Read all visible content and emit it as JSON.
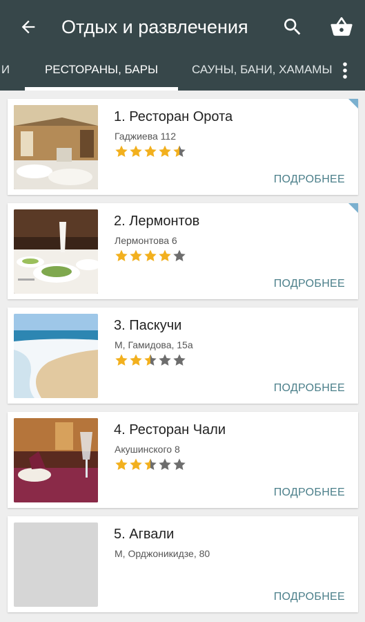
{
  "toolbar": {
    "title": "Отдых и развлечения",
    "back_icon": "arrow-back-icon",
    "search_icon": "search-icon",
    "cart_icon": "basket-icon"
  },
  "tabs": {
    "items": [
      {
        "label": "И"
      },
      {
        "label": "РЕСТОРАНЫ, БАРЫ"
      },
      {
        "label": "САУНЫ, БАНИ, ХАМАМЫ"
      }
    ],
    "active_index": 1,
    "overflow_icon": "more-vertical-icon"
  },
  "colors": {
    "appbar": "#37474a",
    "accent_text": "#4b7f8a",
    "star_filled": "#f2b01e",
    "star_empty": "#6d6d6d",
    "corner_marker": "#7ab0cf"
  },
  "places": [
    {
      "name": "1. Ресторан Орота",
      "address": "Гаджиева 112",
      "rating": 4.5,
      "has_photo": true,
      "photo": "restaurant-hall",
      "featured": true,
      "more_label": "ПОДРОБНЕЕ"
    },
    {
      "name": "2. Лермонтов",
      "address": "Лермонтова 6",
      "rating": 4,
      "has_photo": true,
      "photo": "table-setting",
      "featured": true,
      "more_label": "ПОДРОБНЕЕ"
    },
    {
      "name": "3. Паскучи",
      "address": "М, Гамидова, 15а",
      "rating": 2.5,
      "has_photo": true,
      "photo": "beach-wave",
      "featured": false,
      "more_label": "ПОДРОБНЕЕ"
    },
    {
      "name": "4. Ресторан Чали",
      "address": "Акушинского 8",
      "rating": 2.5,
      "has_photo": true,
      "photo": "wine-glasses",
      "featured": false,
      "more_label": "ПОДРОБНЕЕ"
    },
    {
      "name": "5. Агвали",
      "address": "М, Орджоникидзе, 80",
      "rating": null,
      "has_photo": false,
      "photo": "placeholder",
      "featured": false,
      "more_label": "ПОДРОБНЕЕ"
    }
  ]
}
